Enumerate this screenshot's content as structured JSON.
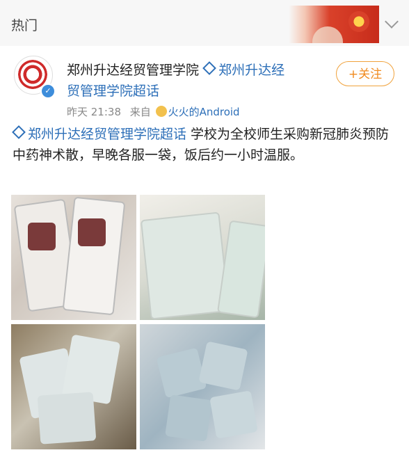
{
  "header": {
    "tab_label": "热门"
  },
  "post": {
    "author": "郑州升达经贸管理学院",
    "topic_link": "郑州升达经贸管理学院超话",
    "time": "昨天 21:38",
    "source_prefix": "来自",
    "source": "火火的Android",
    "follow_label": "+关注",
    "hashtag": "郑州升达经贸管理学院超话",
    "text": " 学校为全校师生采购新冠肺炎预防中药神术散，早晚各服一袋，饭后约一小时温服。",
    "images": [
      "photo-1",
      "photo-2",
      "photo-3",
      "photo-4"
    ]
  },
  "colors": {
    "link": "#2d6fb8",
    "follow": "#f08a1e"
  },
  "icons": [
    "chevron-down-icon",
    "verified-icon",
    "supertopic-icon",
    "emoji-icon"
  ]
}
